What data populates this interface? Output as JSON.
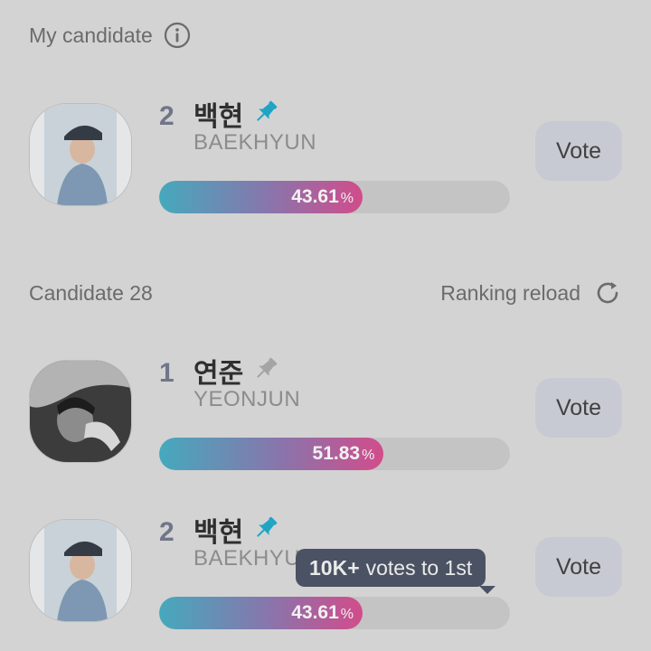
{
  "my_candidate": {
    "title": "My candidate",
    "card": {
      "rank": "2",
      "name_ko": "백현",
      "name_en": "BAEKHYUN",
      "percent": "43.61",
      "percent_value": 43.61,
      "pinned": true,
      "vote_label": "Vote"
    }
  },
  "ranking": {
    "title": "Candidate 28",
    "reload_label": "Ranking reload",
    "cards": [
      {
        "rank": "1",
        "name_ko": "연준",
        "name_en": "YEONJUN",
        "percent": "51.83",
        "percent_value": 51.83,
        "pinned": false,
        "vote_label": "Vote"
      },
      {
        "rank": "2",
        "name_ko": "백현",
        "name_en": "BAEKHYUN",
        "percent": "43.61",
        "percent_value": 43.61,
        "pinned": true,
        "vote_label": "Vote"
      }
    ]
  },
  "percent_unit": "%",
  "tooltip": {
    "bold": "10K+",
    "text": "votes to 1st"
  },
  "colors": {
    "pin_active": "#1fa4c4",
    "pin_inactive": "#a4a4a4",
    "bar_start": "#45a9bd",
    "bar_end": "#d24c8b"
  },
  "icons": {
    "info": "info-icon",
    "reload": "reload-icon",
    "pin": "pin-icon"
  }
}
